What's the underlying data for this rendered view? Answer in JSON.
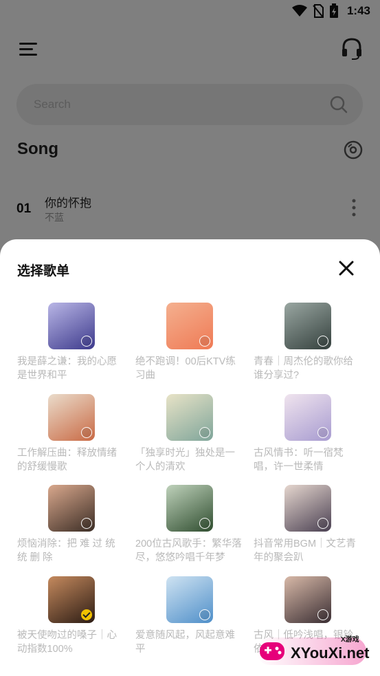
{
  "status_bar": {
    "time": "1:43"
  },
  "search": {
    "placeholder": "Search"
  },
  "section": {
    "title": "Song"
  },
  "song": {
    "number": "01",
    "name": "你的怀抱",
    "artist": "不蓝"
  },
  "sheet": {
    "title": "选择歌单",
    "playlists": [
      {
        "name": "我是薛之谦：我的心愿是世界和平",
        "selected": false,
        "colors": [
          "#3d3a8c",
          "#b9b6e6"
        ]
      },
      {
        "name": "绝不跑调！00后KTV练习曲",
        "selected": false,
        "colors": [
          "#ef7a55",
          "#f4b08f"
        ]
      },
      {
        "name": "青春｜周杰伦的歌你给谁分享过?",
        "selected": false,
        "colors": [
          "#34403d",
          "#9aa7a2"
        ]
      },
      {
        "name": "工作解压曲：释放情绪的舒缓慢歌",
        "selected": false,
        "colors": [
          "#c96a45",
          "#eadccb"
        ]
      },
      {
        "name": "「独享时光」独处是一个人的清欢",
        "selected": false,
        "colors": [
          "#7fa59a",
          "#e8e3c7"
        ]
      },
      {
        "name": "古风情书：听一宿梵唱，许一世柔情",
        "selected": false,
        "colors": [
          "#a79bd0",
          "#f0e4ee"
        ]
      },
      {
        "name": "烦恼消除：把 难 过 统 统 删 除",
        "selected": false,
        "colors": [
          "#3b2d25",
          "#d9a88d"
        ]
      },
      {
        "name": "200位古风歌手：繁华落尽，悠悠吟唱千年梦",
        "selected": false,
        "colors": [
          "#2f4d2f",
          "#bfd2bb"
        ]
      },
      {
        "name": "抖音常用BGM｜文艺青年的聚会趴",
        "selected": false,
        "colors": [
          "#4a4052",
          "#e6d7cf"
        ]
      },
      {
        "name": "被天使吻过的嗓子｜心动指数100%",
        "selected": true,
        "colors": [
          "#2c1c14",
          "#c58a5e"
        ]
      },
      {
        "name": "爱意随风起，风起意难平",
        "selected": false,
        "colors": [
          "#4f8fc9",
          "#cfe3f2"
        ]
      },
      {
        "name": "古风｜低吟浅唱，银铃依",
        "selected": false,
        "colors": [
          "#3a2e33",
          "#d8b9a8"
        ]
      }
    ]
  },
  "watermark": {
    "brand": "XYouXi.net",
    "sub": "X游戏"
  },
  "icons": {
    "menu": "hamburger-icon",
    "headset": "headset-icon",
    "search": "search-icon",
    "disc": "disc-icon",
    "more": "more-vertical-icon",
    "close": "close-icon"
  }
}
